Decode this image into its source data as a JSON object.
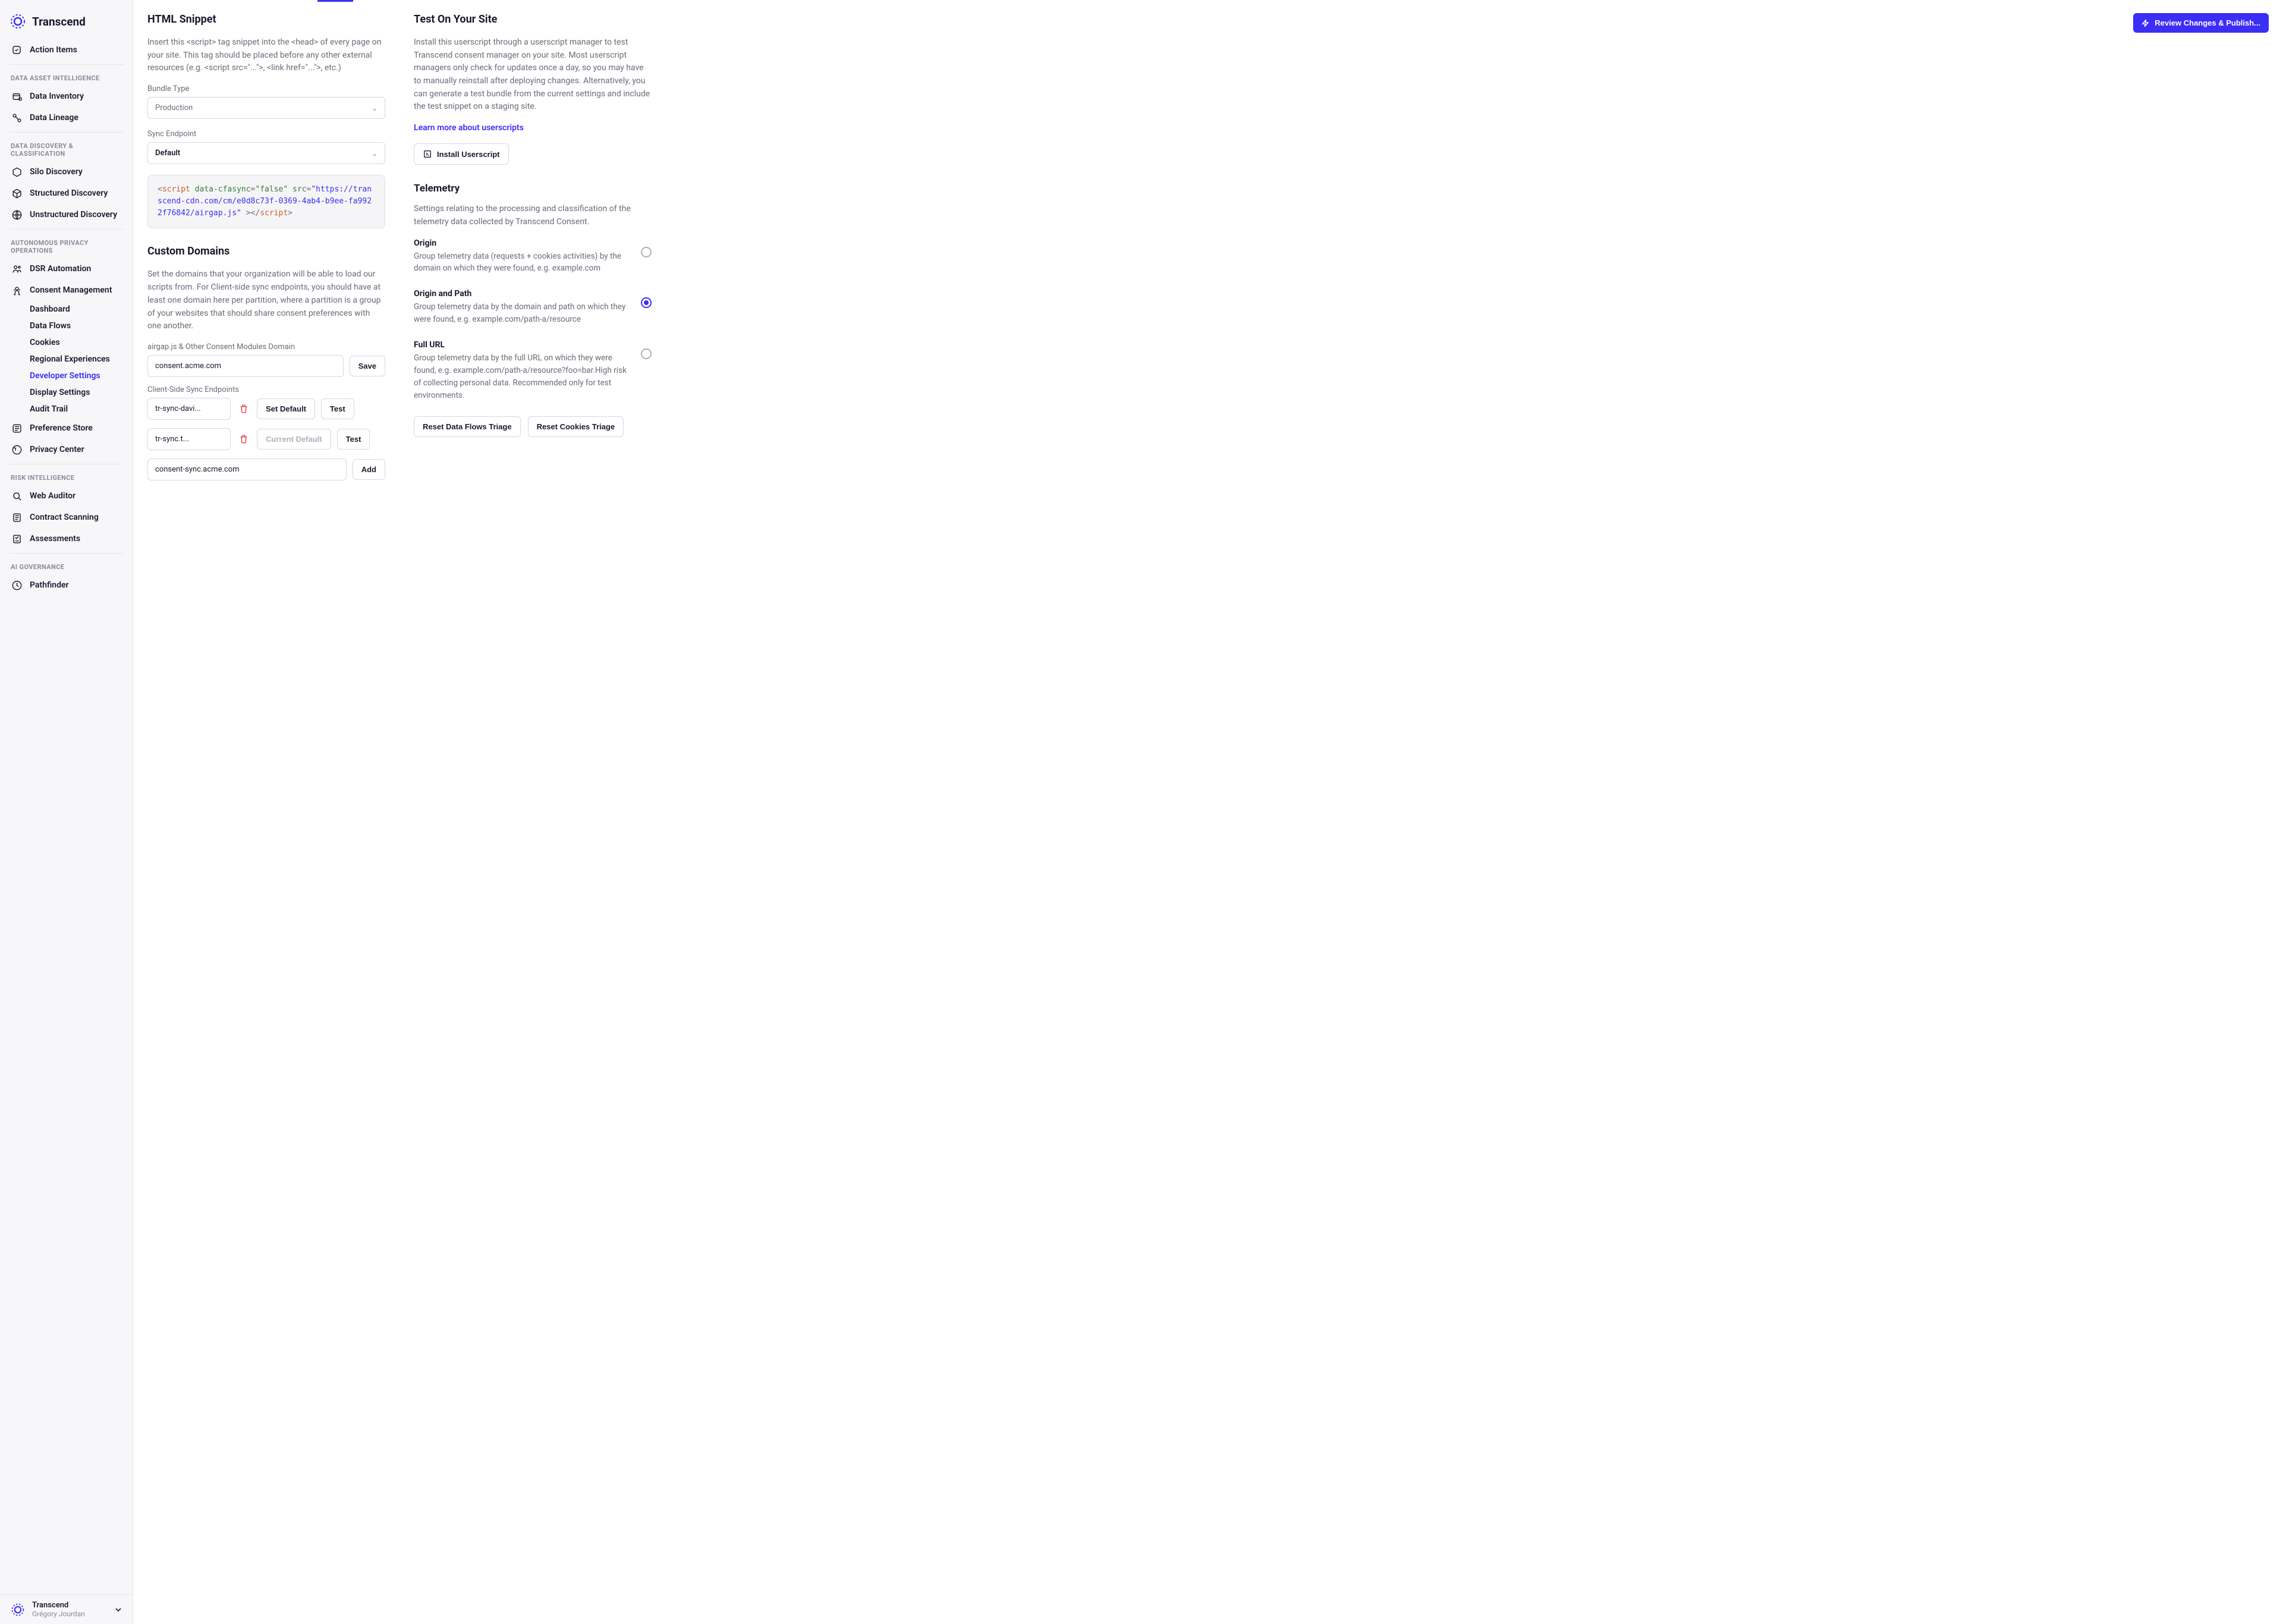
{
  "brand": "Transcend",
  "topButton": "Review Changes & Publish...",
  "nav": {
    "actionItems": "Action Items",
    "groups": [
      {
        "heading": "DATA ASSET INTELLIGENCE",
        "items": [
          {
            "label": "Data Inventory"
          },
          {
            "label": "Data Lineage"
          }
        ]
      },
      {
        "heading": "DATA DISCOVERY & CLASSIFICATION",
        "items": [
          {
            "label": "Silo Discovery"
          },
          {
            "label": "Structured Discovery"
          },
          {
            "label": "Unstructured Discovery"
          }
        ]
      },
      {
        "heading": "AUTONOMOUS PRIVACY OPERATIONS",
        "items": [
          {
            "label": "DSR Automation"
          },
          {
            "label": "Consent Management",
            "children": [
              "Dashboard",
              "Data Flows",
              "Cookies",
              "Regional Experiences",
              "Developer Settings",
              "Display Settings",
              "Audit Trail"
            ],
            "activeChild": "Developer Settings"
          },
          {
            "label": "Preference Store"
          },
          {
            "label": "Privacy Center"
          }
        ]
      },
      {
        "heading": "RISK INTELLIGENCE",
        "items": [
          {
            "label": "Web Auditor"
          },
          {
            "label": "Contract Scanning"
          },
          {
            "label": "Assessments"
          }
        ]
      },
      {
        "heading": "AI GOVERNANCE",
        "items": [
          {
            "label": "Pathfinder"
          }
        ]
      }
    ]
  },
  "account": {
    "org": "Transcend",
    "user": "Grégory Jourdan"
  },
  "left": {
    "snippetTitle": "HTML Snippet",
    "snippetDesc": "Insert this <script> tag snippet into the <head> of every page on your site. This tag should be placed before any other external resources (e.g. <script src=\"...\">, <link href=\"...\">, etc.)",
    "bundleTypeLabel": "Bundle Type",
    "bundleTypeValue": "Production",
    "syncEndpointLabel": "Sync Endpoint",
    "syncEndpointValue": "Default",
    "code": {
      "src": "https://transcend-cdn.com/cm/e0d8c73f-0369-4ab4-b9ee-fa9922f76842/airgap.js"
    },
    "customTitle": "Custom Domains",
    "customDesc": "Set the domains that your organization will be able to load our scripts from. For Client-side sync endpoints, you should have at least one domain here per partition, where a partition is a group of your websites that should share consent preferences with one another.",
    "domainLabel": "airgap.js & Other Consent Modules Domain",
    "domainValue": "consent.acme.com",
    "saveBtn": "Save",
    "syncEndpointsLabel": "Client-Side Sync Endpoints",
    "endpoints": [
      {
        "value": "tr-sync-davi...",
        "btn": "Set Default",
        "disabled": false,
        "test": "Test"
      },
      {
        "value": "tr-sync.t...",
        "btn": "Current Default",
        "disabled": true,
        "test": "Test"
      }
    ],
    "addValue": "consent-sync.acme.com",
    "addBtn": "Add"
  },
  "right": {
    "testTitle": "Test On Your Site",
    "testDesc": "Install this userscript through a userscript manager to test Transcend consent manager on your site. Most userscript managers only check for updates once a day, so you may have to manually reinstall after deploying changes. Alternatively, you can generate a test bundle from the current settings and include the test snippet on a staging site.",
    "learnMore": "Learn more about userscripts",
    "installBtn": "Install Userscript",
    "telemetryTitle": "Telemetry",
    "telemetryDesc": "Settings relating to the processing and classification of the telemetry data collected by Transcend Consent.",
    "options": [
      {
        "title": "Origin",
        "desc": "Group telemetry data (requests + cookies activities) by the domain on which they were found, e.g. example.com",
        "selected": false
      },
      {
        "title": "Origin and Path",
        "desc": "Group telemetry data by the domain and path on which they were found, e.g. example.com/path-a/resource",
        "selected": true
      },
      {
        "title": "Full URL",
        "desc": "Group telemetry data by the full URL on which they were found, e.g. example.com/path-a/resource?foo=bar.High risk of collecting personal data. Recommended only for test environments.",
        "selected": false
      }
    ],
    "resetDataFlows": "Reset Data Flows Triage",
    "resetCookies": "Reset Cookies Triage"
  }
}
